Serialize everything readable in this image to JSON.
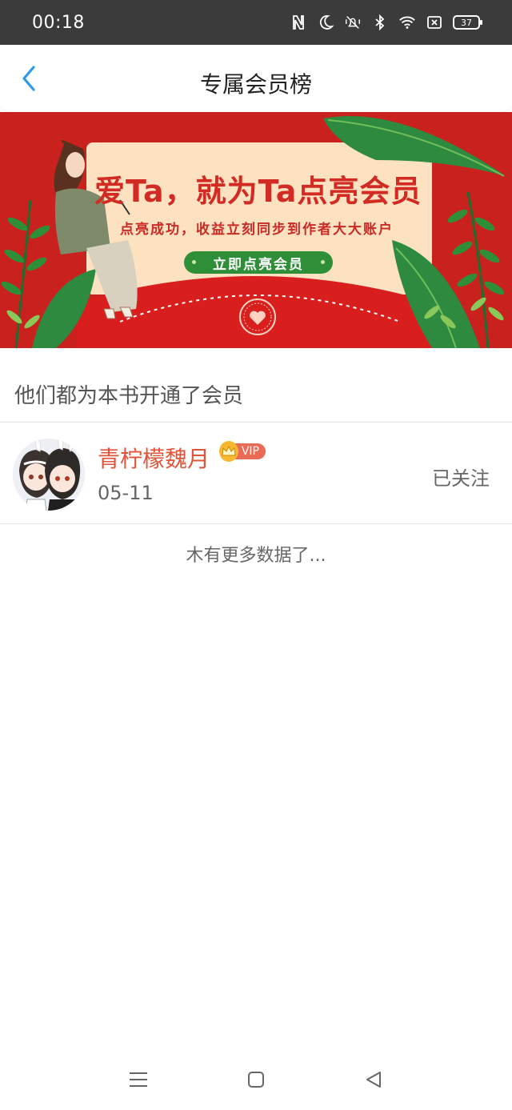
{
  "status_bar": {
    "time": "00:18",
    "battery": "37",
    "icons": [
      "nfc-icon",
      "do-not-disturb-icon",
      "vibrate-off-icon",
      "bluetooth-icon",
      "wifi-icon",
      "sim-error-icon",
      "battery-icon"
    ]
  },
  "header": {
    "title": "专属会员榜",
    "back_icon": "chevron-left-icon",
    "accent_color": "#2f9be6"
  },
  "banner": {
    "headline": "爱Ta，就为Ta点亮会员",
    "subtitle": "点亮成功，收益立刻同步到作者大大账户",
    "cta_label": "立即点亮会员",
    "background_color": "#c8211e"
  },
  "section": {
    "heading": "他们都为本书开通了会员"
  },
  "members": [
    {
      "name": "青柠檬魏月",
      "badge": "VIP",
      "date": "05-11",
      "follow_status": "已关注",
      "name_color": "#e0543a"
    }
  ],
  "list_end_text": "木有更多数据了...",
  "nav_bar": {
    "icons": [
      "menu-icon",
      "home-icon",
      "back-triangle-icon"
    ]
  }
}
